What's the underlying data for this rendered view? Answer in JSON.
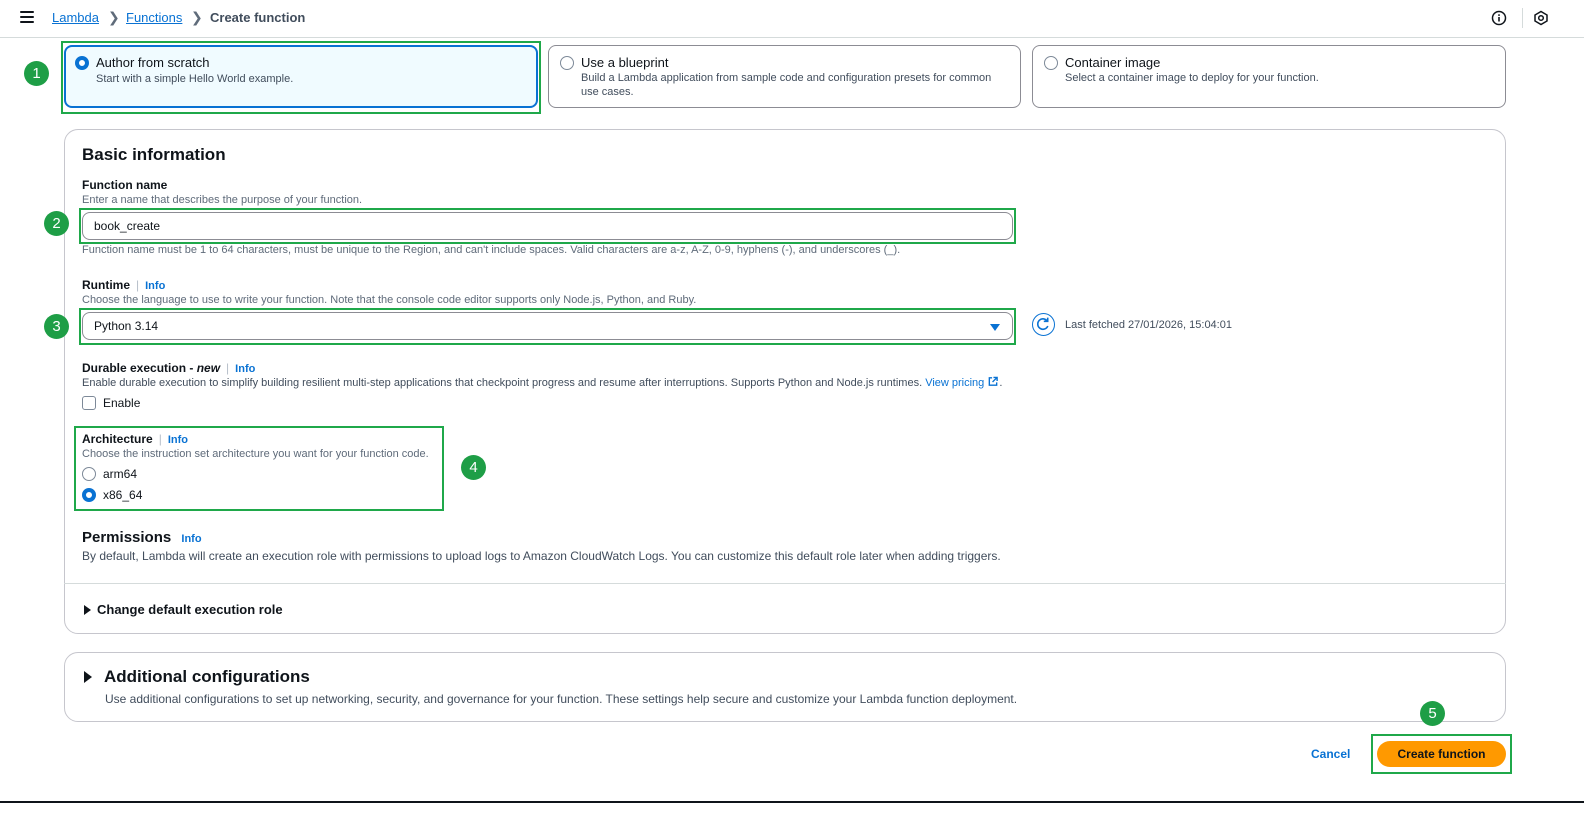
{
  "breadcrumb": {
    "root": "Lambda",
    "parent": "Functions",
    "current": "Create function"
  },
  "tiles": [
    {
      "title": "Author from scratch",
      "desc": "Start with a simple Hello World example.",
      "selected": true
    },
    {
      "title": "Use a blueprint",
      "desc": "Build a Lambda application from sample code and configuration presets for common use cases.",
      "selected": false
    },
    {
      "title": "Container image",
      "desc": "Select a container image to deploy for your function.",
      "selected": false
    }
  ],
  "basic": {
    "heading": "Basic information",
    "function_name": {
      "label": "Function name",
      "desc": "Enter a name that describes the purpose of your function.",
      "value": "book_create",
      "hint": "Function name must be 1 to 64 characters, must be unique to the Region, and can't include spaces. Valid characters are a-z, A-Z, 0-9, hyphens (-), and underscores (_)."
    },
    "runtime": {
      "label": "Runtime",
      "info": "Info",
      "desc": "Choose the language to use to write your function. Note that the console code editor supports only Node.js, Python, and Ruby.",
      "value": "Python 3.14",
      "last_fetched": "Last fetched 27/01/2026, 15:04:01"
    },
    "durable": {
      "label": "Durable execution - ",
      "label_new": "new",
      "info": "Info",
      "desc": "Enable durable execution to simplify building resilient multi-step applications that checkpoint progress and resume after interruptions. Supports Python and Node.js runtimes.",
      "link": "View pricing",
      "checkbox_label": "Enable"
    },
    "architecture": {
      "label": "Architecture",
      "info": "Info",
      "desc": "Choose the instruction set architecture you want for your function code.",
      "options": [
        "arm64",
        "x86_64"
      ],
      "selected": "x86_64"
    },
    "permissions": {
      "label": "Permissions",
      "info": "Info",
      "desc": "By default, Lambda will create an execution role with permissions to upload logs to Amazon CloudWatch Logs. You can customize this default role later when adding triggers."
    },
    "change_role": "Change default execution role"
  },
  "additional": {
    "heading": "Additional configurations",
    "desc": "Use additional configurations to set up networking, security, and governance for your function. These settings help secure and customize your Lambda function deployment."
  },
  "actions": {
    "cancel": "Cancel",
    "create": "Create function"
  },
  "badges": [
    "1",
    "2",
    "3",
    "4",
    "5"
  ],
  "colors": {
    "accent": "#0972d3",
    "primary_button": "#ff9900",
    "highlight": "#1fa84a"
  }
}
